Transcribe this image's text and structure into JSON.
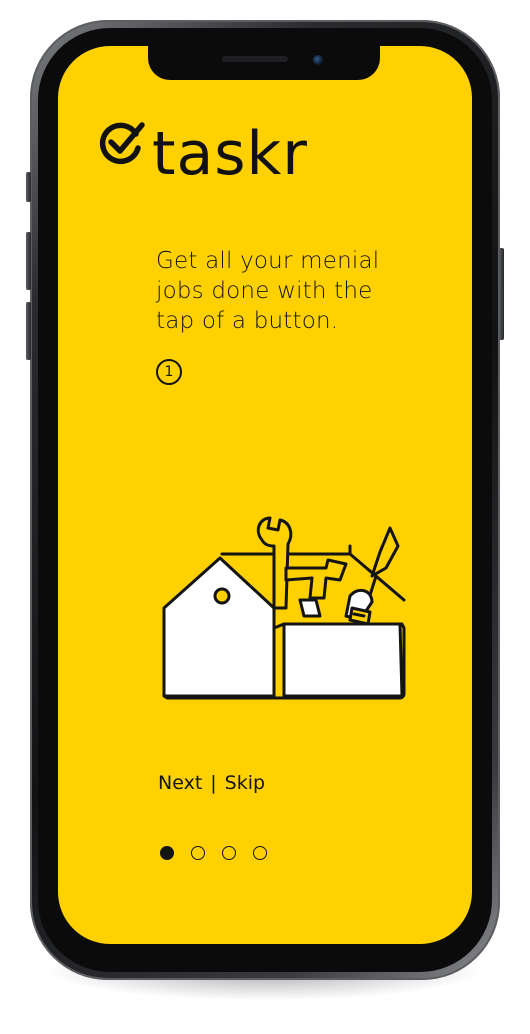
{
  "app": {
    "brand": "taskr",
    "accent_color": "#ffd100",
    "ink_color": "#141414"
  },
  "onboarding": {
    "headline_lines": [
      "Get all your menial",
      "jobs done with the",
      "tap of a button."
    ],
    "step_number": "1",
    "illustration_icon": "toolbox-with-tools-icon",
    "next_label": "Next",
    "separator": "|",
    "skip_label": "Skip",
    "pager": {
      "total": 4,
      "active_index": 0
    }
  }
}
